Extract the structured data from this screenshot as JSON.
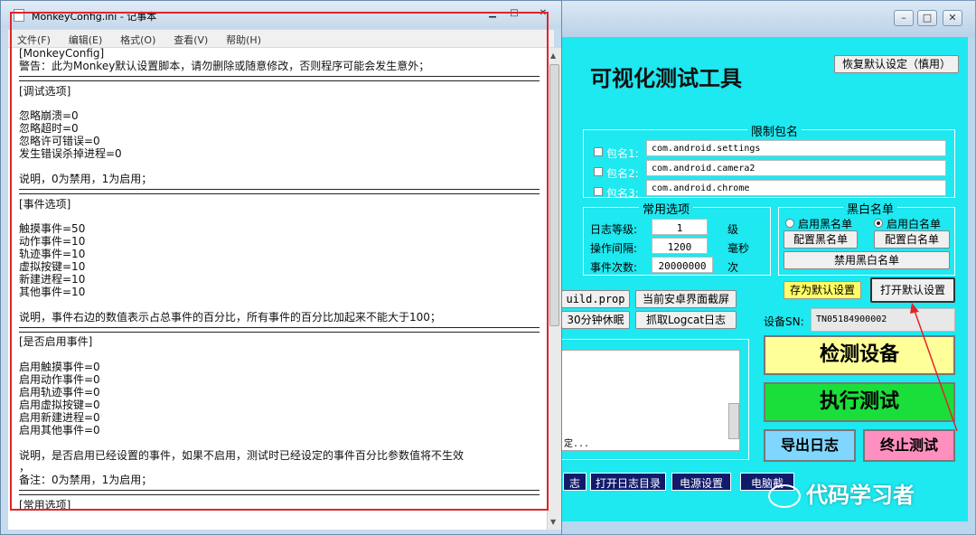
{
  "notepad": {
    "title": "MonkeyConfig.ini - 记事本",
    "menu": [
      "文件(F)",
      "编辑(E)",
      "格式(O)",
      "查看(V)",
      "帮助(H)"
    ],
    "lines": [
      "[MonkeyConfig]",
      "警告：此为Monkey默认设置脚本，请勿删除或随意修改，否则程序可能会发生意外；",
      "=====",
      "[调试选项]",
      "",
      "忽略崩溃=0",
      "忽略超时=0",
      "忽略许可错误=0",
      "发生错误杀掉进程=0",
      "",
      "说明，0为禁用，1为启用；",
      "=====",
      "[事件选项]",
      "",
      "触摸事件=50",
      "动作事件=10",
      "轨迹事件=10",
      "虚拟按键=10",
      "新建进程=10",
      "其他事件=10",
      "",
      "说明，事件右边的数值表示占总事件的百分比，所有事件的百分比加起来不能大于100；",
      "=====",
      "[是否启用事件]",
      "",
      "启用触摸事件=0",
      "启用动作事件=0",
      "启用轨迹事件=0",
      "启用虚拟按键=0",
      "启用新建进程=0",
      "启用其他事件=0",
      "",
      "说明，是否启用已经设置的事件，如果不启用，测试时已经设定的事件百分比参数值将不生效",
      "，",
      "备注：0为禁用，1为启用；",
      "=====",
      "[常用选项]"
    ]
  },
  "tool": {
    "title": "可视化测试工具",
    "restore_default": "恢复默认设定（慎用）",
    "restrict_group": "限制包名",
    "packages": [
      {
        "label": "包名1:",
        "value": "com.android.settings"
      },
      {
        "label": "包名2:",
        "value": "com.android.camera2"
      },
      {
        "label": "包名3:",
        "value": "com.android.chrome"
      }
    ],
    "common_group": "常用选项",
    "log_level_label": "日志等级:",
    "log_level": "1",
    "log_level_unit": "级",
    "interval_label": "操作间隔:",
    "interval": "1200",
    "interval_unit": "毫秒",
    "events_label": "事件次数:",
    "events": "20000000",
    "events_unit": "次",
    "bw_group": "黑白名单",
    "use_black": "启用黑名单",
    "use_white": "启用白名单",
    "config_black": "配置黑名单",
    "config_white": "配置白名单",
    "disable_bw": "禁用黑白名单",
    "save_default": "存为默认设置",
    "open_default": "打开默认设置",
    "build_prop": "uild.prop",
    "screenshot": "当前安卓界面截屏",
    "sleep": "30分钟休眠",
    "logcat": "抓取Logcat日志",
    "device_sn_label": "设备SN:",
    "device_sn": "TN05184900002",
    "detect": "检测设备",
    "run": "执行测试",
    "export_log": "导出日志",
    "stop": "终止测试",
    "log_tail": "定...",
    "bottom_btns": [
      "志",
      "打开日志目录",
      "电源设置",
      "电脑截"
    ]
  },
  "watermark": "代码学习者",
  "colors": {
    "tool_bg": "#1ee8f0",
    "detect": "#ffff99",
    "run": "#1adf3a",
    "export": "#7fd6ff",
    "stop": "#ff8fbf",
    "annotation": "#e0242c"
  }
}
